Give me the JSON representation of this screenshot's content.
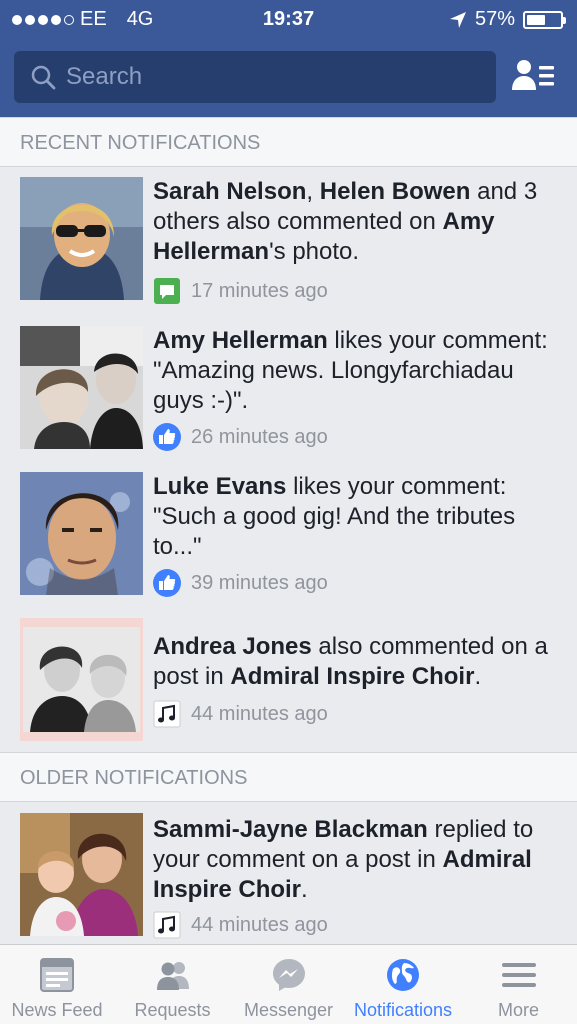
{
  "status_bar": {
    "carrier": "EE",
    "network": "4G",
    "time": "19:37",
    "battery_text": "57%",
    "battery_level": 0.57
  },
  "search": {
    "placeholder": "Search"
  },
  "sections": {
    "recent": "RECENT NOTIFICATIONS",
    "older": "OLDER NOTIFICATIONS"
  },
  "notifications": [
    {
      "parts": [
        {
          "text": "Sarah Nelson",
          "bold": true
        },
        {
          "text": ", ",
          "bold": false
        },
        {
          "text": "Helen Bowen",
          "bold": true
        },
        {
          "text": " and 3 others also commented on ",
          "bold": false
        },
        {
          "text": "Amy Hellerman",
          "bold": true
        },
        {
          "text": "'s photo.",
          "bold": false
        }
      ],
      "time": "17 minutes ago",
      "icon": "comment-icon"
    },
    {
      "parts": [
        {
          "text": "Amy Hellerman",
          "bold": true
        },
        {
          "text": " likes your comment: \"Amazing news. Llongyfarchiadau guys :-)\".",
          "bold": false
        }
      ],
      "time": "26 minutes ago",
      "icon": "like-icon"
    },
    {
      "parts": [
        {
          "text": "Luke Evans",
          "bold": true
        },
        {
          "text": " likes your comment: \"Such a good gig! And the tributes to...\"",
          "bold": false
        }
      ],
      "time": "39 minutes ago",
      "icon": "like-icon"
    },
    {
      "parts": [
        {
          "text": "Andrea Jones",
          "bold": true
        },
        {
          "text": " also commented on a post in ",
          "bold": false
        },
        {
          "text": "Admiral Inspire Choir",
          "bold": true
        },
        {
          "text": ".",
          "bold": false
        }
      ],
      "time": "44 minutes ago",
      "icon": "music-note-icon"
    },
    {
      "parts": [
        {
          "text": "Sammi-Jayne Blackman",
          "bold": true
        },
        {
          "text": " replied to your comment on a post in ",
          "bold": false
        },
        {
          "text": "Admiral Inspire Choir",
          "bold": true
        },
        {
          "text": ".",
          "bold": false
        }
      ],
      "time": "44 minutes ago",
      "icon": "music-note-icon"
    }
  ],
  "tabs": [
    {
      "label": "News Feed",
      "icon": "news-feed-icon",
      "active": false
    },
    {
      "label": "Requests",
      "icon": "friend-requests-icon",
      "active": false
    },
    {
      "label": "Messenger",
      "icon": "messenger-icon",
      "active": false
    },
    {
      "label": "Notifications",
      "icon": "globe-icon",
      "active": true
    },
    {
      "label": "More",
      "icon": "menu-icon",
      "active": false
    }
  ],
  "colors": {
    "brand": "#3b5998",
    "active_tab": "#4080ff",
    "like": "#4080ff",
    "comment": "#4caf50"
  }
}
